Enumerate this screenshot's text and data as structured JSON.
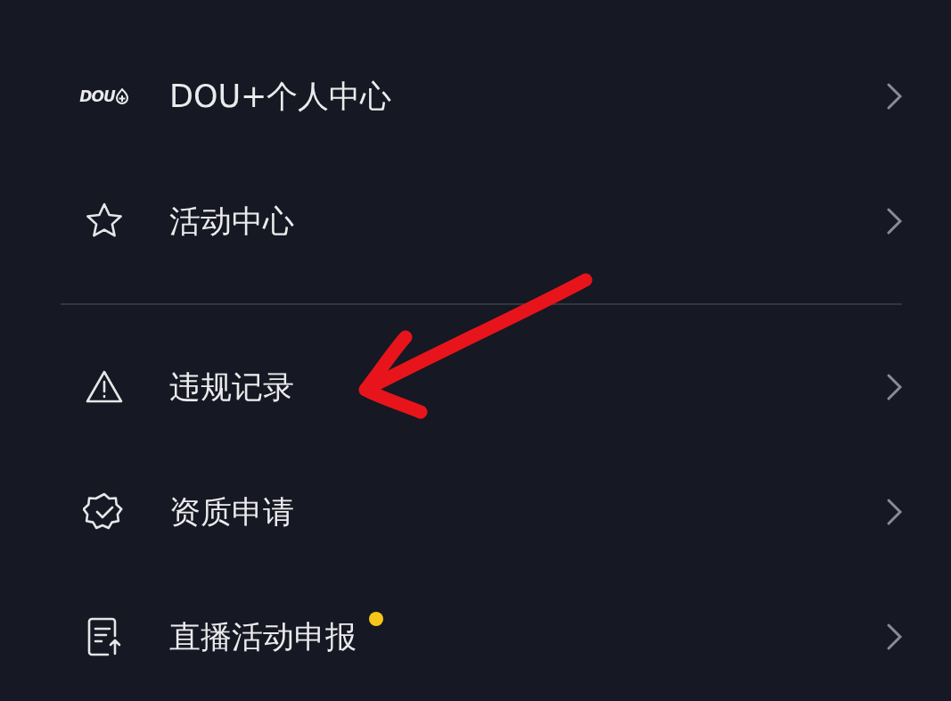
{
  "sections": [
    {
      "items": [
        {
          "kind": "dou",
          "logo_text": "DOU",
          "label": "DOU+个人中心",
          "new_dot": false
        },
        {
          "kind": "star",
          "label": "活动中心",
          "new_dot": false
        }
      ]
    },
    {
      "items": [
        {
          "kind": "warning",
          "label": "违规记录",
          "new_dot": false
        },
        {
          "kind": "verified",
          "label": "资质申请",
          "new_dot": false
        },
        {
          "kind": "document",
          "label": "直播活动申报",
          "new_dot": true
        }
      ]
    }
  ]
}
